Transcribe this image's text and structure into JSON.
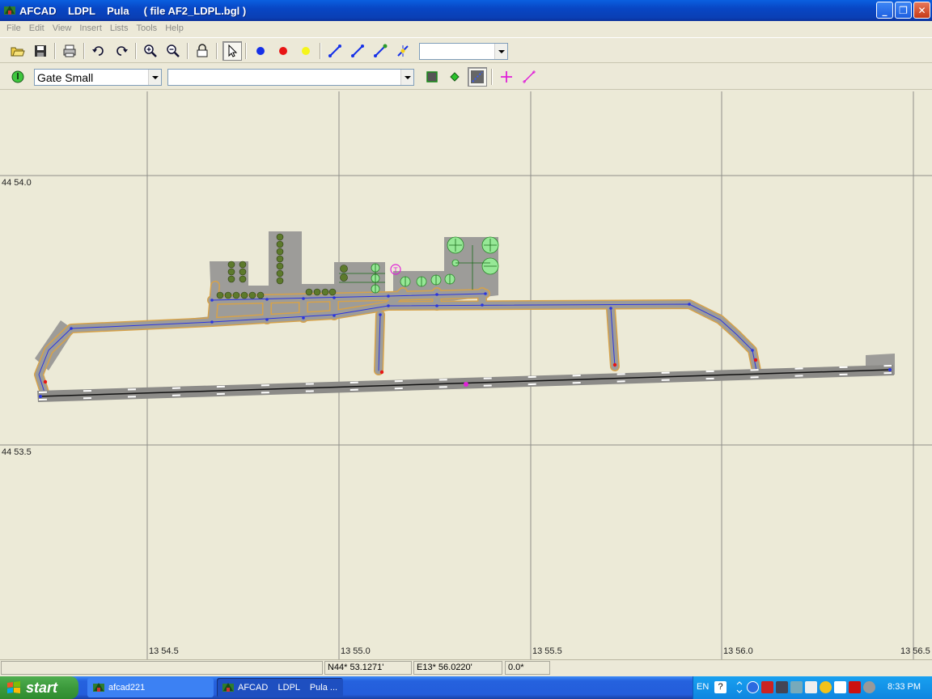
{
  "window": {
    "title": "AFCAD    LDPL    Pula     ( file AF2_LDPL.bgl )",
    "min_label": "_",
    "max_label": "❐",
    "close_label": "✕"
  },
  "menu": [
    "File",
    "Edit",
    "View",
    "Insert",
    "Lists",
    "Tools",
    "Help"
  ],
  "toolbar2": {
    "parking_type": "Gate Small",
    "name_combo": "",
    "view_combo": ""
  },
  "map": {
    "lat_labels": [
      "44 54.0",
      "44 53.5"
    ],
    "lon_labels": [
      "13 54.5",
      "13 55.0",
      "13 55.5",
      "13 56.0",
      "13 56.5"
    ],
    "tower_label": "T"
  },
  "status": {
    "empty": "",
    "lat": "N44* 53.1271'",
    "lon": "E13* 56.0220'",
    "heading": "0.0*"
  },
  "taskbar": {
    "start_label": "start",
    "tasks": [
      "afcad221",
      "AFCAD    LDPL    Pula ..."
    ],
    "lang": "EN",
    "clock": "8:33 PM"
  },
  "colors": {
    "map_bg": "#ecead7",
    "apron": "#9c9b98",
    "taxiway_edge": "#d6a24a",
    "node": "#2a35e0",
    "parking_green": "#8ee38e",
    "parking_dark": "#5a7a2a"
  }
}
